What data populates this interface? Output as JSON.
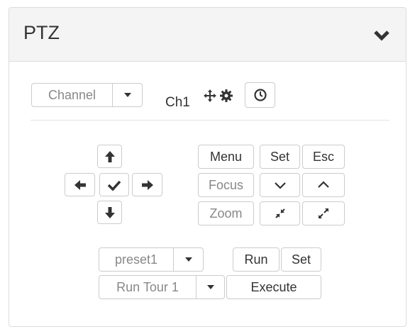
{
  "panel": {
    "title": "PTZ",
    "collapse_icon": "chevron-down-icon"
  },
  "channel": {
    "select_label": "Channel",
    "current": "Ch1",
    "icons": [
      "move-arrows-icon",
      "gear-icon",
      "clock-icon"
    ]
  },
  "direction_pad": {
    "up_icon": "arrow-up-icon",
    "left_icon": "arrow-left-icon",
    "center_icon": "check-icon",
    "right_icon": "arrow-right-icon",
    "down_icon": "arrow-down-icon"
  },
  "controls": {
    "menu_label": "Menu",
    "set_label": "Set",
    "esc_label": "Esc",
    "focus_label": "Focus",
    "zoom_label": "Zoom",
    "focus_down_icon": "chevron-down-icon",
    "focus_up_icon": "chevron-up-icon",
    "zoom_out_icon": "compress-icon",
    "zoom_in_icon": "expand-icon"
  },
  "preset": {
    "select_value": "preset1",
    "run_label": "Run",
    "set_label": "Set"
  },
  "tour": {
    "select_value": "Run Tour 1",
    "execute_label": "Execute"
  },
  "colors": {
    "border": "#cccccc",
    "heading_bg": "#f4f4f4",
    "text": "#333333",
    "muted_text": "#888888"
  }
}
